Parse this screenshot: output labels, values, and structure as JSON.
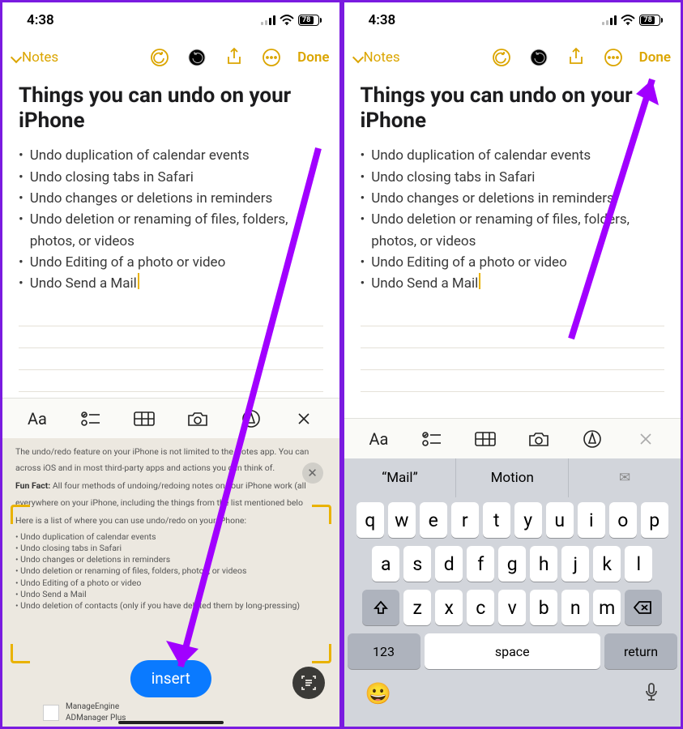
{
  "status": {
    "time": "4:38",
    "battery": "78"
  },
  "nav": {
    "back_label": "Notes",
    "done_label": "Done"
  },
  "note": {
    "title": "Things you can undo on your iPhone",
    "bullets": [
      "Undo duplication of calendar events",
      "Undo closing tabs in Safari",
      "Undo changes or deletions in reminders",
      "Undo deletion or renaming of files, folders, photos, or videos",
      "Undo Editing of a photo or video",
      "Undo Send a Mail"
    ]
  },
  "formatbar": {
    "text_style": "Aa"
  },
  "scan": {
    "line1": "The undo/redo feature on your iPhone is not limited to the Notes app. You can",
    "line2": "across iOS and in most third-party apps and actions you can think of.",
    "funfact_label": "Fun Fact:",
    "funfact_text": "All four methods of undoing/redoing notes on your iPhone work (all",
    "funfact_text2": "everywhere on your iPhone, including the things from the list mentioned belo",
    "list_intro": "Here is a list of where you can use undo/redo on your iPhone:",
    "items": [
      "Undo duplication of calendar events",
      "Undo closing tabs in Safari",
      "Undo changes or deletions in reminders",
      "Undo deletion or renaming of files, folders, photos, or videos",
      "Undo Editing of a photo or video",
      "Undo Send a Mail",
      "Undo deletion of contacts (only if you have deleted them by long-pressing)"
    ],
    "insert_label": "insert",
    "ad_title": "ManageEngine",
    "ad_sub": "ADManager Plus"
  },
  "keyboard": {
    "suggest": [
      "Mail",
      "Motion",
      "✉︎"
    ],
    "row1": [
      "q",
      "w",
      "e",
      "r",
      "t",
      "y",
      "u",
      "i",
      "o",
      "p"
    ],
    "row2": [
      "a",
      "s",
      "d",
      "f",
      "g",
      "h",
      "j",
      "k",
      "l"
    ],
    "row3": [
      "z",
      "x",
      "c",
      "v",
      "b",
      "n",
      "m"
    ],
    "numkey": "123",
    "space": "space",
    "return": "return"
  }
}
